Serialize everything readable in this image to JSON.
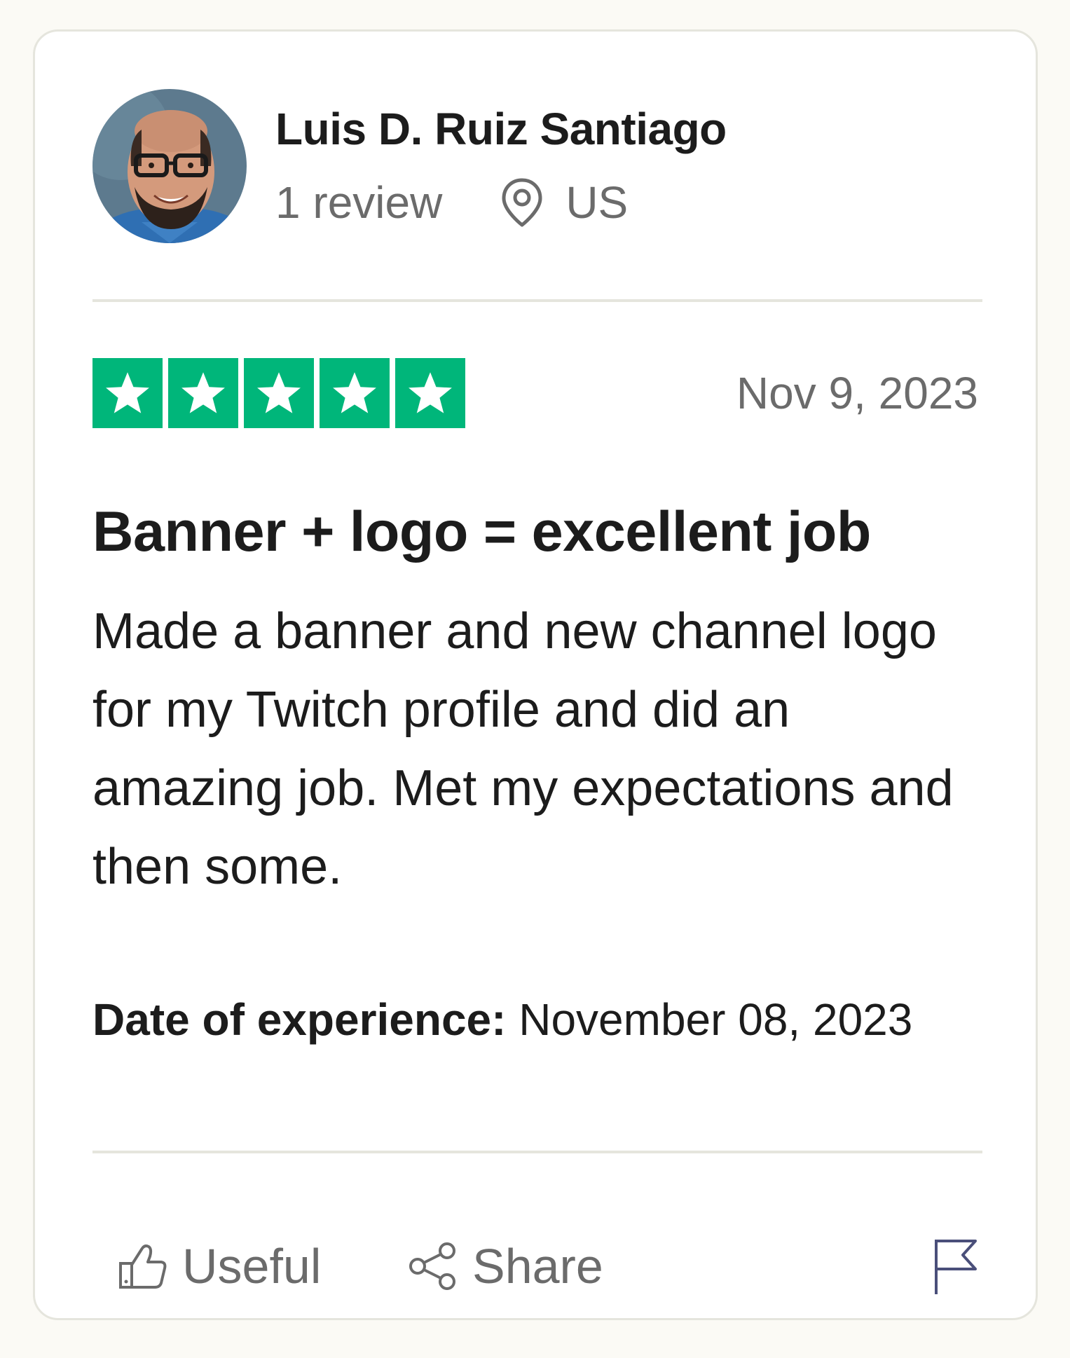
{
  "reviewer": {
    "name": "Luis D. Ruiz Santiago",
    "review_count": "1 review",
    "country": "US"
  },
  "review": {
    "rating": 5,
    "max_rating": 5,
    "date": "Nov 9, 2023",
    "title": "Banner + logo = excellent job",
    "text": "Made a banner and new channel logo for my Twitch profile and did an amazing job. Met my expectations and then some.",
    "experience_label": "Date of experience:",
    "experience_date": "November 08, 2023"
  },
  "actions": {
    "useful_label": "Useful",
    "share_label": "Share"
  },
  "icons": {
    "avatar": "avatar-photo",
    "location": "location-pin-icon",
    "star": "star-icon",
    "useful": "thumbs-up-icon",
    "share": "share-icon",
    "report": "flag-icon"
  },
  "colors": {
    "star_green": "#00b67a",
    "muted_text": "#6b6b6b",
    "divider": "#e5e5dd",
    "flag_icon": "#4a4f7a"
  }
}
